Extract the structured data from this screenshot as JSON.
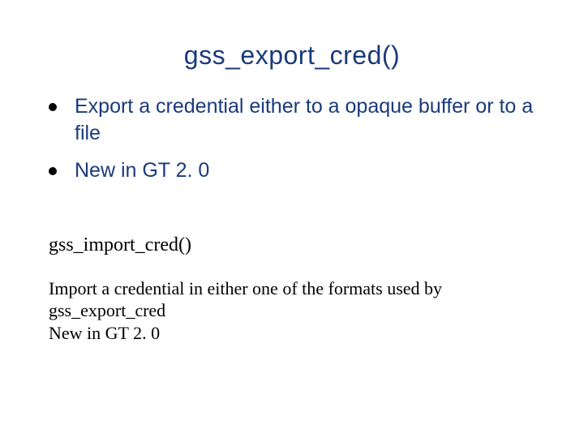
{
  "title": "gss_export_cred()",
  "bullets": [
    "Export a credential either to a opaque buffer or to a file",
    "New in GT 2. 0"
  ],
  "subheading": "gss_import_cred()",
  "body_lines": [
    "Import a credential in either one of the formats used by gss_export_cred",
    "New in GT 2. 0"
  ]
}
